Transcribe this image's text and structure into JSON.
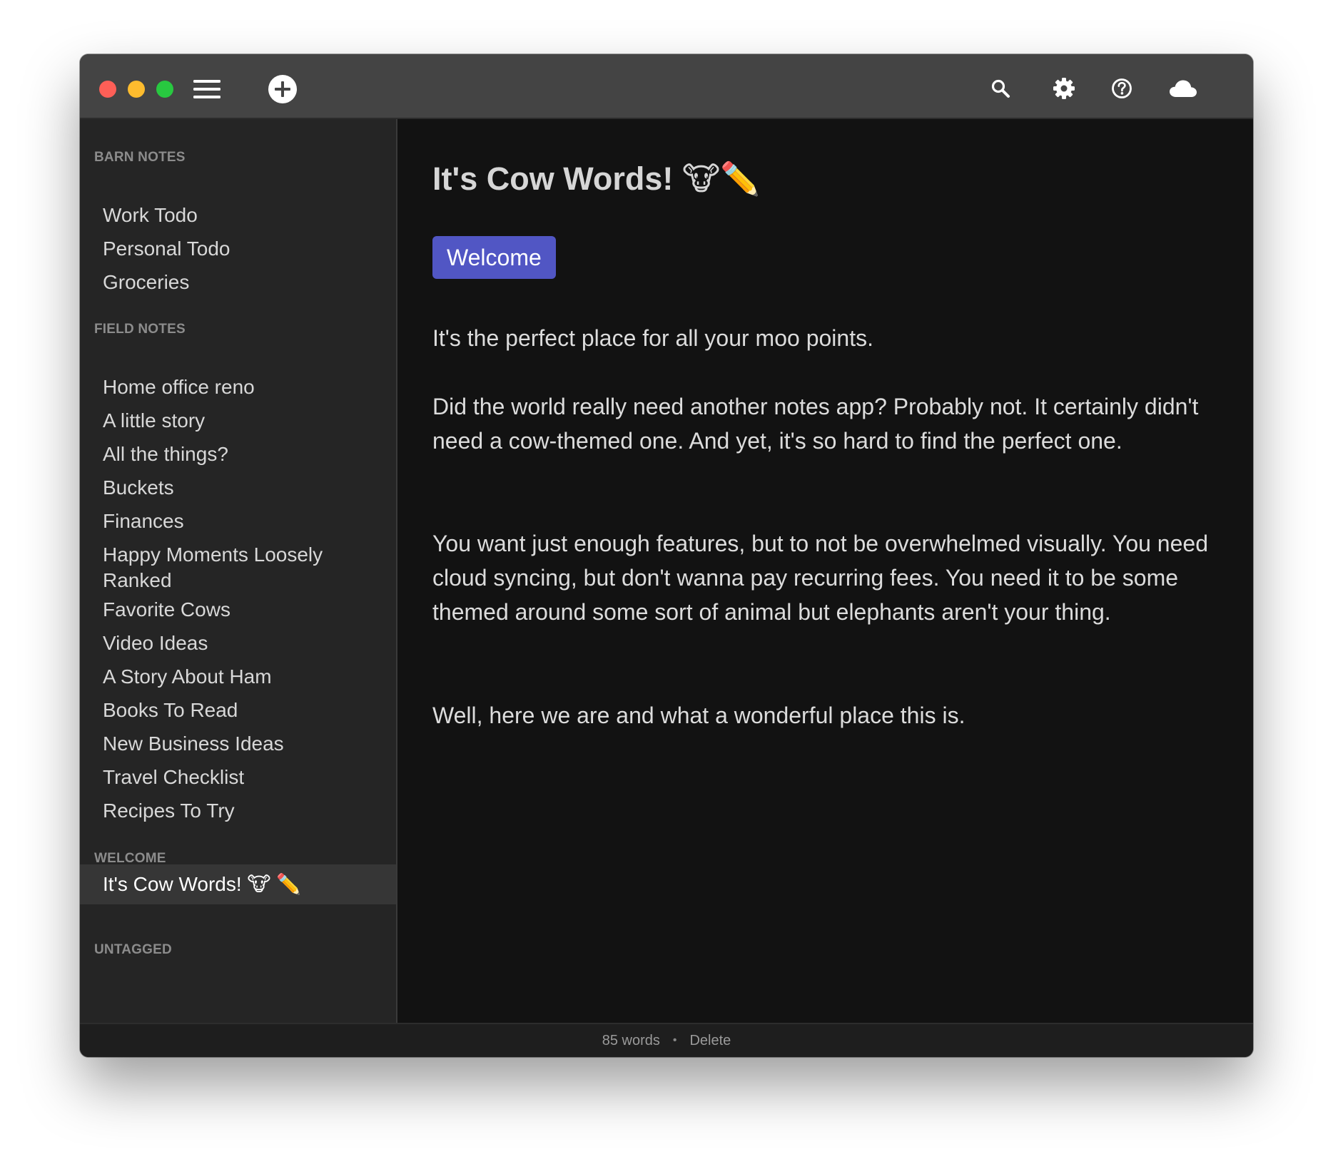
{
  "window": {
    "controls": {
      "close_color": "#fe5f57",
      "minimize_color": "#febc2e",
      "zoom_color": "#28c840"
    }
  },
  "toolbar": {
    "icons": [
      "menu-icon",
      "add-icon",
      "search-icon",
      "gear-icon",
      "help-icon",
      "cloud-icon"
    ]
  },
  "sidebar": {
    "sections": [
      {
        "title": "BARN NOTES",
        "items": [
          "Work Todo",
          "Personal Todo",
          "Groceries"
        ]
      },
      {
        "title": "FIELD NOTES",
        "items": [
          "Home office reno",
          "A little story",
          "All the things?",
          "Buckets",
          "Finances",
          "Happy Moments Loosely Ranked",
          "Favorite Cows",
          "Video Ideas",
          "A Story About Ham",
          "Books To Read",
          "New Business Ideas",
          "Travel Checklist",
          "Recipes To Try"
        ]
      },
      {
        "title": "WELCOME",
        "items": [
          "It's Cow Words! 🐮 ✏️"
        ],
        "active_item": "It's Cow Words! 🐮 ✏️"
      },
      {
        "title": "UNTAGGED",
        "items": []
      }
    ]
  },
  "note": {
    "title": "It's Cow Words! 🐮✏️",
    "tag": "Welcome",
    "tag_color": "#5156c4",
    "paragraphs": [
      "It's the perfect place for all your moo points.",
      "Did the world really need another notes app? Probably not. It certainly didn't need a cow-themed one. And yet, it's so hard to find the perfect one.",
      "You want just enough features, but to not be overwhelmed visually. You need cloud syncing, but don't wanna pay recurring fees. You need it to be some themed around some sort of animal but elephants aren't your thing.",
      "Well, here we are and what a wonderful place this is."
    ]
  },
  "footer": {
    "word_count": "85 words",
    "separator": "•",
    "delete_label": "Delete"
  }
}
